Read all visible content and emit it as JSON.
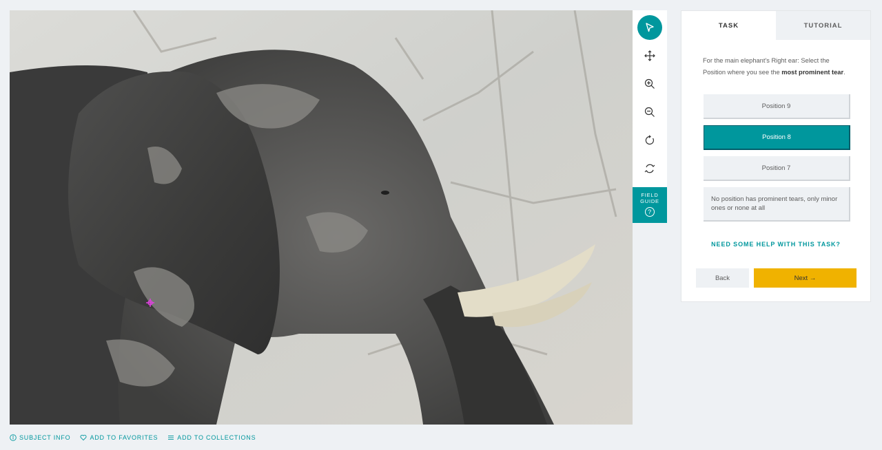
{
  "subject": {
    "image_description_icon": "elephant-photo"
  },
  "toolbar": {
    "tools": [
      {
        "name": "annotate",
        "icon": "pointer-icon"
      },
      {
        "name": "move",
        "icon": "move-icon"
      },
      {
        "name": "zoom_in",
        "icon": "zoom-in-icon"
      },
      {
        "name": "zoom_out",
        "icon": "zoom-out-icon"
      },
      {
        "name": "rotate",
        "icon": "rotate-icon"
      },
      {
        "name": "reset",
        "icon": "reset-icon"
      }
    ],
    "field_guide_line1": "FIELD",
    "field_guide_line2": "GUIDE",
    "field_guide_icon": "?"
  },
  "panel": {
    "tabs": [
      {
        "label": "TASK",
        "selected": true
      },
      {
        "label": "TUTORIAL",
        "selected": false
      }
    ],
    "question_part1": "For the main elephant's Right ear: Select the Position where you see the ",
    "question_bold": "most prominent tear",
    "question_part2": ".",
    "answers": [
      {
        "label": "Position 9",
        "selected": false
      },
      {
        "label": "Position 8",
        "selected": true
      },
      {
        "label": "Position 7",
        "selected": false
      },
      {
        "label": "No position has prominent tears, only minor ones or none at all",
        "selected": false
      }
    ],
    "help_link": "NEED SOME HELP WITH THIS TASK?",
    "back_label": "Back",
    "next_label": "Next →"
  },
  "footer": {
    "subject_info": "SUBJECT INFO",
    "add_favorites": "ADD TO FAVORITES",
    "add_collections": "ADD TO COLLECTIONS"
  },
  "colors": {
    "accent": "#00979d",
    "next_button": "#f0b200",
    "marker": "#e040e0"
  }
}
